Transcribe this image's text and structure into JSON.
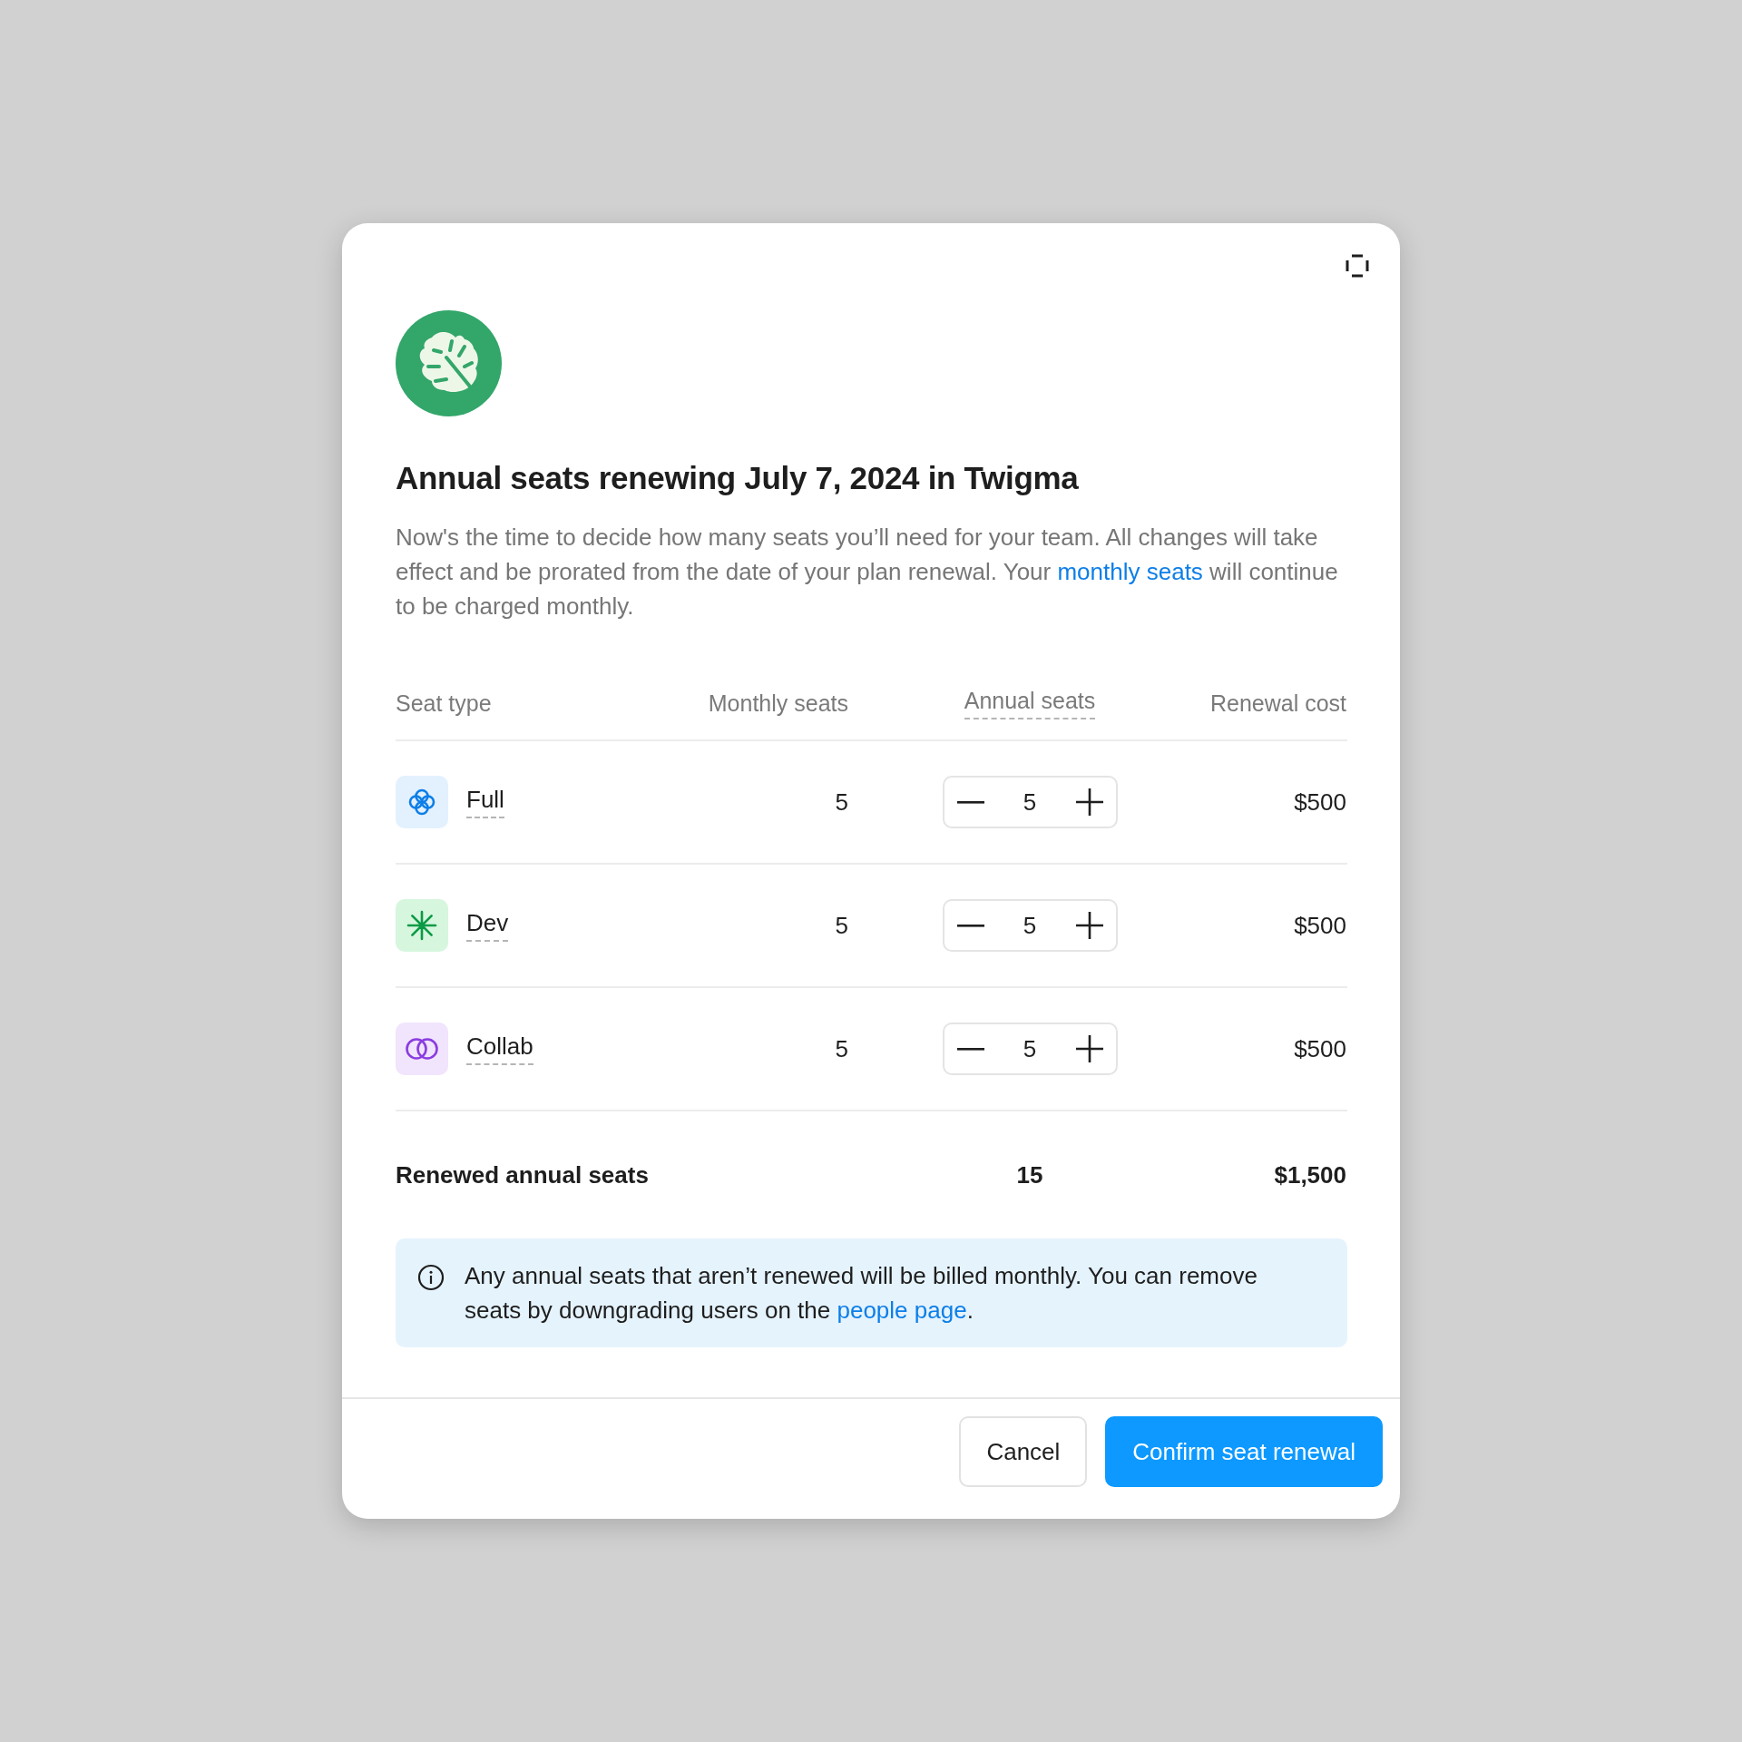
{
  "dialog": {
    "title": "Annual seats renewing July 7, 2024 in Twigma",
    "description": [
      "Now's the time to decide how many seats you’ll need for your team. All changes will take effect and be prorated from the date of your plan renewal. Your ",
      "monthly seats",
      " will continue to be charged monthly."
    ],
    "columns": [
      {
        "label": "Seat type",
        "hint": false
      },
      {
        "label": "Monthly seats",
        "hint": false
      },
      {
        "label": "Annual seats",
        "hint": true
      },
      {
        "label": "Renewal cost",
        "hint": false
      }
    ],
    "rows": [
      {
        "kind": "full",
        "name": "Full",
        "monthly": "5",
        "annual": "5",
        "cost": "$500"
      },
      {
        "kind": "dev",
        "name": "Dev",
        "monthly": "5",
        "annual": "5",
        "cost": "$500"
      },
      {
        "kind": "collab",
        "name": "Collab",
        "monthly": "5",
        "annual": "5",
        "cost": "$500"
      }
    ],
    "total": {
      "label": "Renewed annual seats",
      "annual": "15",
      "cost": "$1,500"
    },
    "notice": [
      "Any annual seats that aren’t renewed will be billed monthly. You can remove seats by downgrading users on the ",
      "people page",
      "."
    ],
    "buttons": [
      {
        "label": "Cancel",
        "kind": "secondary"
      },
      {
        "label": "Confirm seat renewal",
        "kind": "primary"
      }
    ]
  }
}
